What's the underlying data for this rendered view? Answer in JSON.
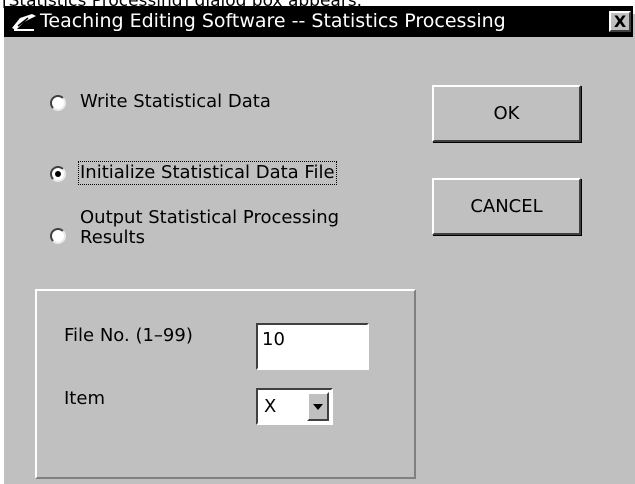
{
  "top_strip": {
    "text": "[Statistics Processing] dialog box appears."
  },
  "window": {
    "title": "Teaching Editing Software -- Statistics Processing",
    "close_label": "X"
  },
  "options": [
    {
      "label": "Write Statistical Data",
      "selected": false
    },
    {
      "label": "Initialize Statistical Data File",
      "selected": true
    },
    {
      "label_line1": "Output Statistical Processing",
      "label_line2": "Results",
      "selected": false
    }
  ],
  "buttons": {
    "ok": "OK",
    "cancel": "CANCEL"
  },
  "fields": {
    "file_no": {
      "label": "File No. (1–99)",
      "value": "10"
    },
    "item": {
      "label": "Item",
      "value": "X"
    }
  },
  "icons": {
    "app": "pen-tool-icon",
    "close": "close-icon",
    "dropdown": "chevron-down-icon"
  }
}
